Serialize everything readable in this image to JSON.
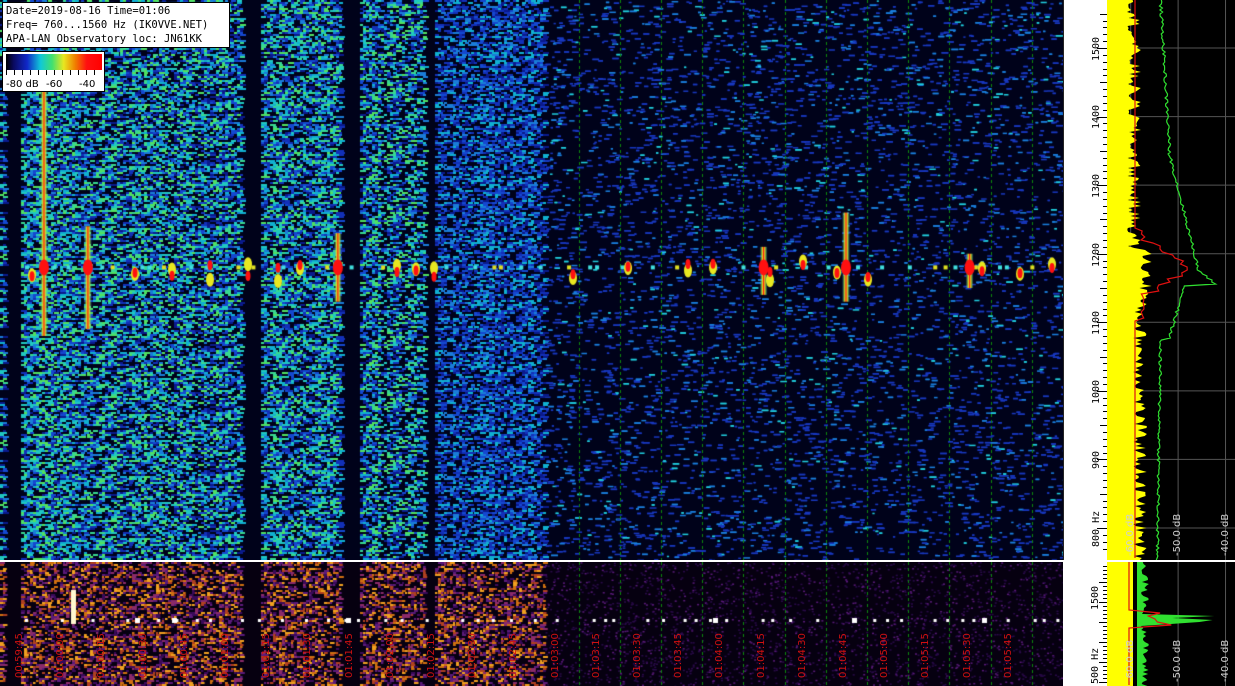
{
  "header": {
    "line1": "Date=2019-08-16 Time=01:06",
    "line2": "Freq= 760...1560 Hz (IK0VVE.NET)",
    "line3": "APA-LAN Observatory loc: JN61KK"
  },
  "colorbar": {
    "label_a": "-80 dB",
    "label_b": "-60",
    "label_c": "-40"
  },
  "freq_axis": {
    "ticks": [
      "1500",
      "1400",
      "1300",
      "1200",
      "1100",
      "1000",
      "900",
      "800 Hz"
    ],
    "ticks_small": [
      "1500",
      "500 Hz"
    ]
  },
  "spectrum_axis": {
    "labels": [
      "-60.0 dB",
      "-50.0 dB",
      "-40.0 dB"
    ]
  },
  "time_axis": {
    "labels": [
      "00:59:45",
      "01:00:00",
      "01:00:15",
      "01:00:30",
      "01:00:45",
      "01:01:00",
      "01:01:15",
      "01:01:30",
      "01:01:45",
      "01:02:00",
      "01:02:15",
      "01:02:30",
      "01:02:45",
      "01:03:00",
      "01:03:15",
      "01:03:30",
      "01:03:45",
      "01:04:00",
      "01:04:15",
      "01:04:30",
      "01:04:45",
      "01:05:00",
      "01:05:15",
      "01:05:30",
      "01:05:45"
    ]
  },
  "colors": {
    "background": "#00021a",
    "grid_line": "#0c8a0c",
    "signal_hot": "#ff1010",
    "time_label": "#d01010",
    "spectrum_avg": "#ffff00",
    "spectrum_peak": "#30e030",
    "spectrum_current": "#e01010"
  },
  "chart_data": {
    "type": "heatmap",
    "title": "Date=2019-08-16 Time=01:06",
    "xlabel": "",
    "ylabel": "Hz",
    "ylim": [
      760,
      1560
    ],
    "colorbar_range_db": [
      -80,
      -40
    ],
    "y_ticks": [
      800,
      900,
      1000,
      1100,
      1200,
      1300,
      1400,
      1500
    ],
    "x_ticks": [
      "00:59:45",
      "01:00:00",
      "01:00:15",
      "01:00:30",
      "01:00:45",
      "01:01:00",
      "01:01:15",
      "01:01:30",
      "01:01:45",
      "01:02:00",
      "01:02:15",
      "01:02:30",
      "01:02:45",
      "01:03:00",
      "01:03:15",
      "01:03:30",
      "01:03:45",
      "01:04:00",
      "01:04:15",
      "01:04:30",
      "01:04:45",
      "01:05:00",
      "01:05:15",
      "01:05:30",
      "01:05:45"
    ],
    "carrier_freq_hz": 1180,
    "strong_events": [
      {
        "time": "00:59:53",
        "freq_low": 1080,
        "freq_high": 1490,
        "level_db": -40
      },
      {
        "time": "01:00:09",
        "freq_low": 1090,
        "freq_high": 1240,
        "level_db": -45
      },
      {
        "time": "01:01:40",
        "freq_low": 1130,
        "freq_high": 1230,
        "level_db": -45
      },
      {
        "time": "01:04:15",
        "freq_low": 1140,
        "freq_high": 1210,
        "level_db": -48
      },
      {
        "time": "01:04:45",
        "freq_low": 1130,
        "freq_high": 1260,
        "level_db": -45
      },
      {
        "time": "01:05:30",
        "freq_low": 1150,
        "freq_high": 1200,
        "level_db": -48
      }
    ],
    "spectrum_xlim_db": [
      -65,
      -38
    ],
    "spectrum_labels": [
      "-60.0 dB",
      "-50.0 dB",
      "-40.0 dB"
    ]
  }
}
